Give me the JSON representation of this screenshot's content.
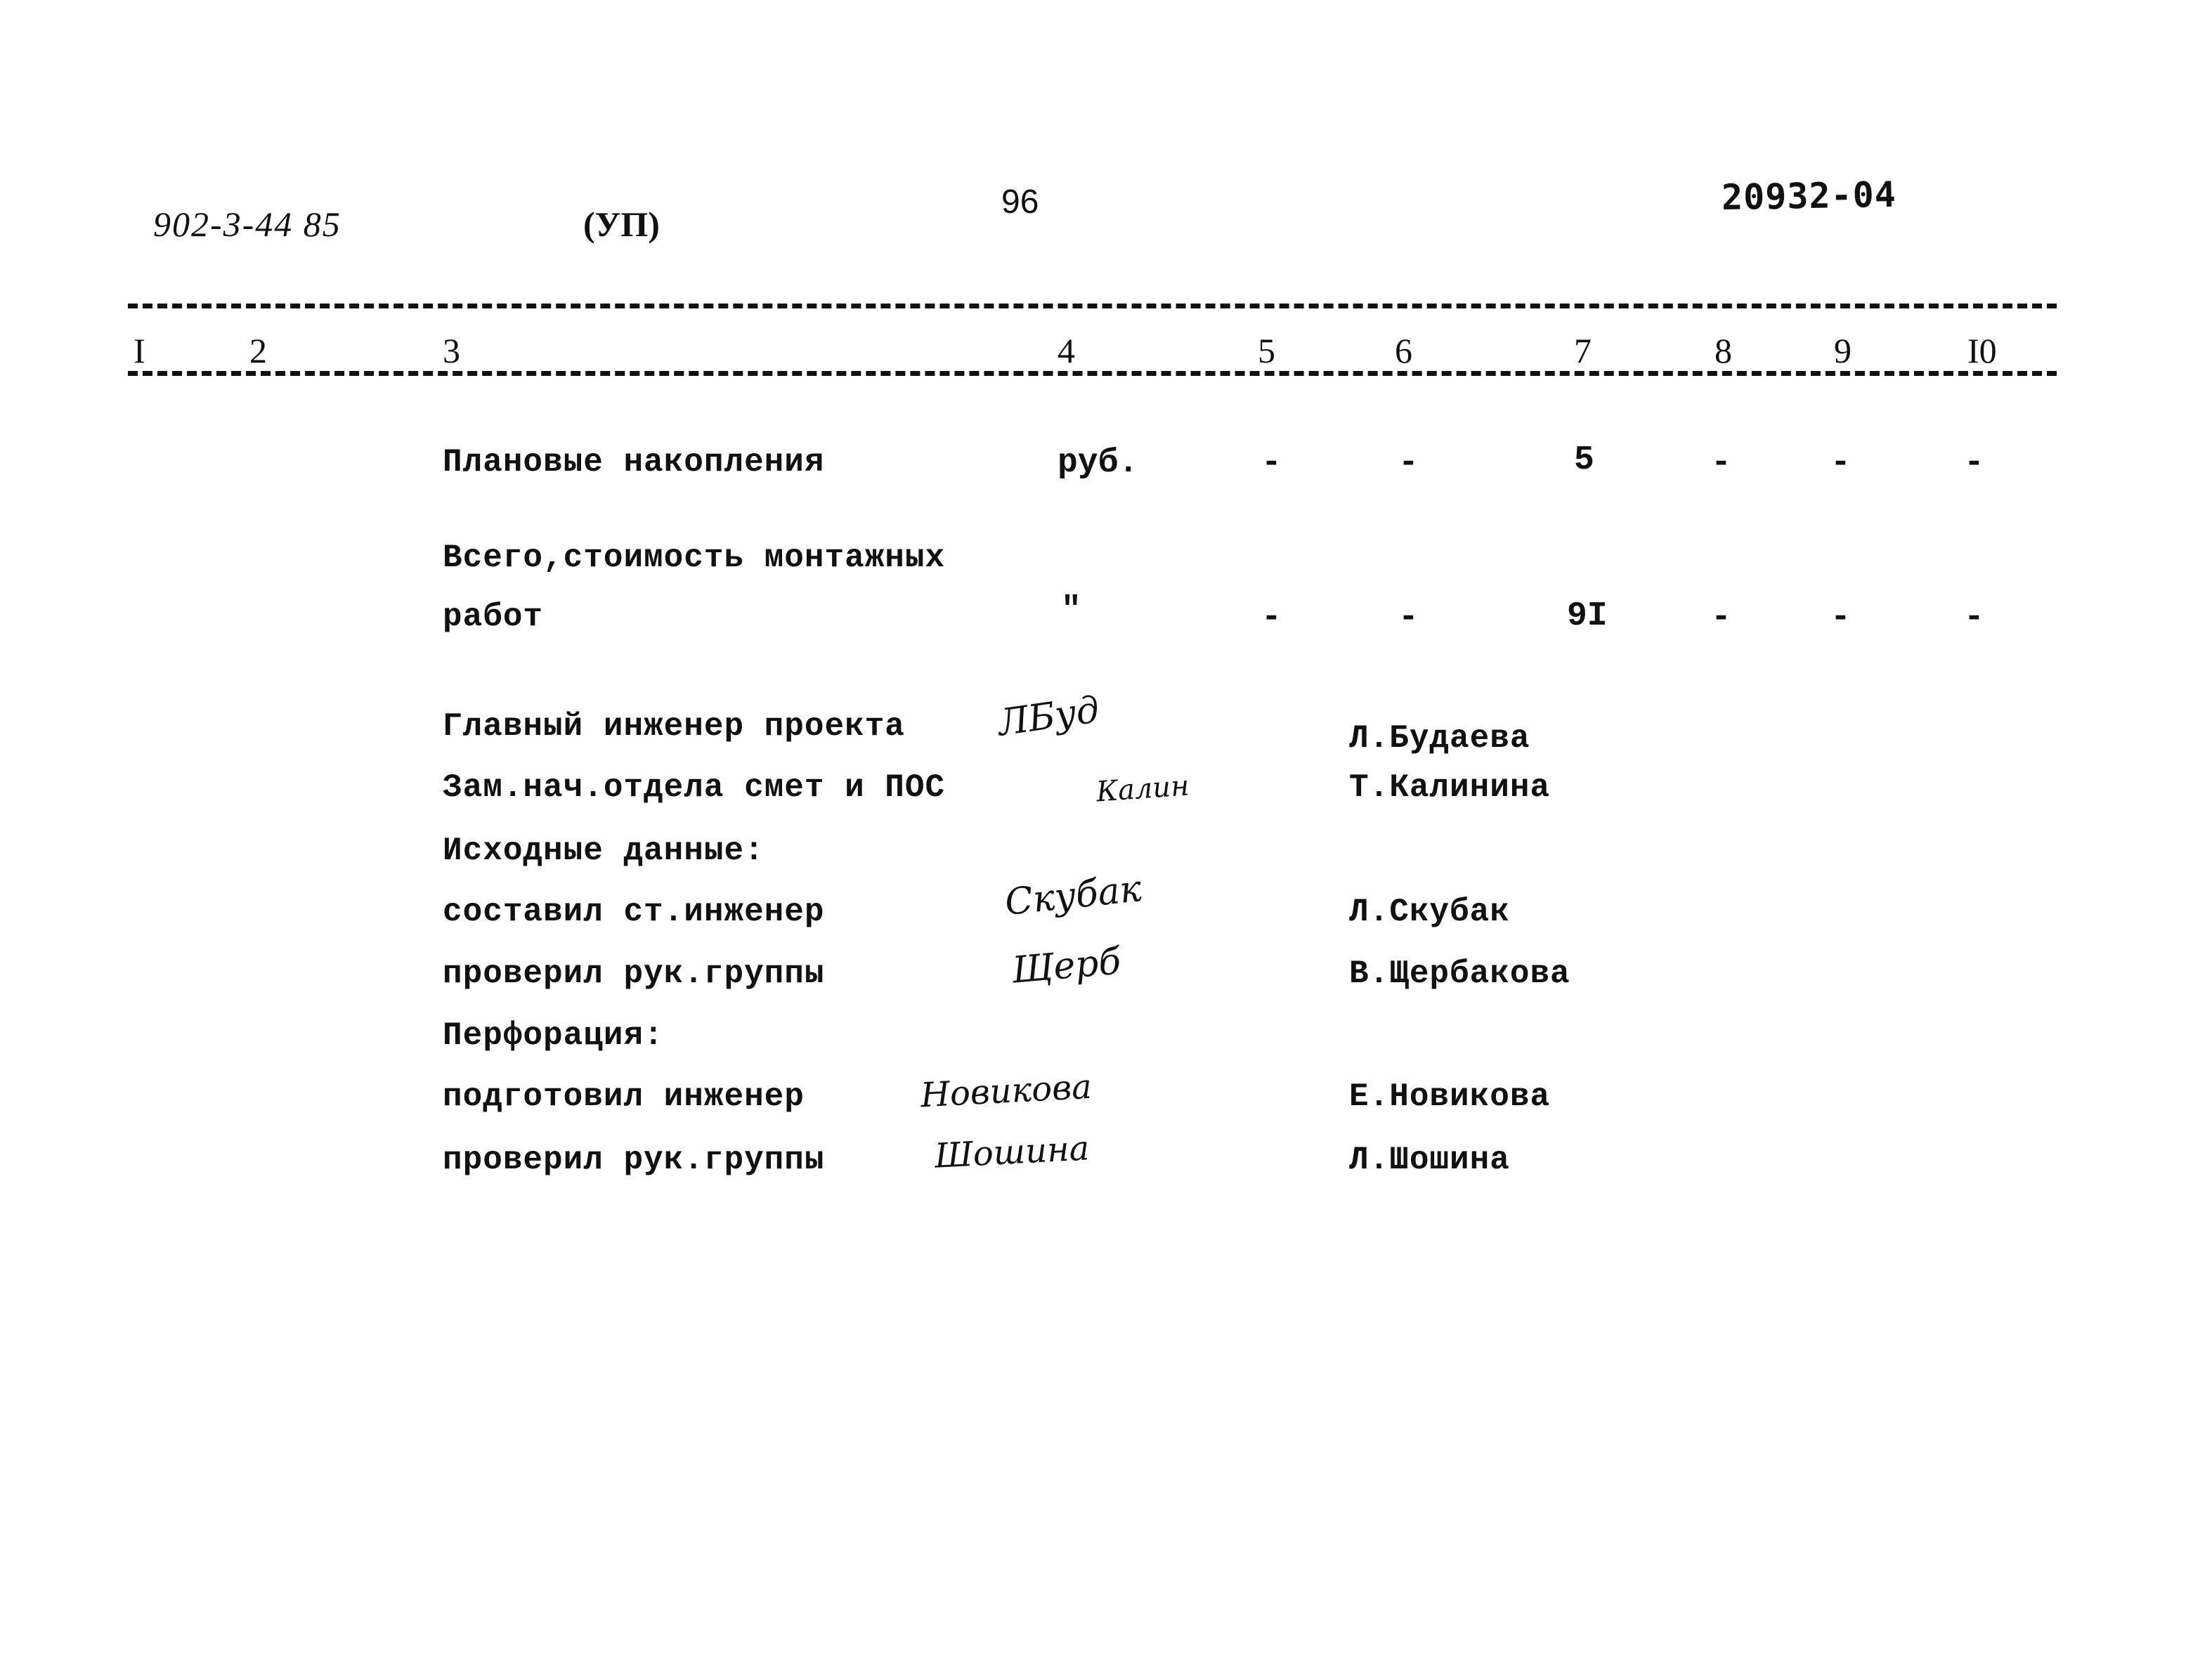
{
  "header": {
    "project_code": "902-3-44 85",
    "section_mark": "(УП)",
    "page_number": "96",
    "document_number": "20932-04"
  },
  "table": {
    "column_numbers": [
      "I",
      "2",
      "3",
      "4",
      "5",
      "6",
      "7",
      "8",
      "9",
      "I0"
    ],
    "rows": [
      {
        "name": "Плановые накопления",
        "unit": "руб.",
        "c5": "-",
        "c6": "-",
        "c7": "5",
        "c8": "-",
        "c9": "-",
        "c10": "-"
      },
      {
        "name_line1": "Всего,стоимость монтажных",
        "name_line2": "работ",
        "unit": "\"",
        "c5": "-",
        "c6": "-",
        "c7": "9I",
        "c8": "-",
        "c9": "-",
        "c10": "-"
      }
    ]
  },
  "signatures": {
    "entries": [
      {
        "role": "Главный инженер проекта",
        "signature": "ЛБуд",
        "name": "Л.Будаева"
      },
      {
        "role": "Зам.нач.отдела смет и ПОС",
        "signature": "Калин",
        "name": "Т.Калинина"
      },
      {
        "role": "Исходные данные:"
      },
      {
        "role": "составил ст.инженер",
        "signature": "Скубак",
        "name": "Л.Скубак"
      },
      {
        "role": "проверил рук.группы",
        "signature": "Щерб",
        "name": "В.Щербакова"
      },
      {
        "role": "Перфорация:"
      },
      {
        "role": "подготовил инженер",
        "signature": "Новикова",
        "name": "Е.Новикова"
      },
      {
        "role": "проверил рук.группы",
        "signature": "Шошина",
        "name": "Л.Шошина"
      }
    ]
  }
}
